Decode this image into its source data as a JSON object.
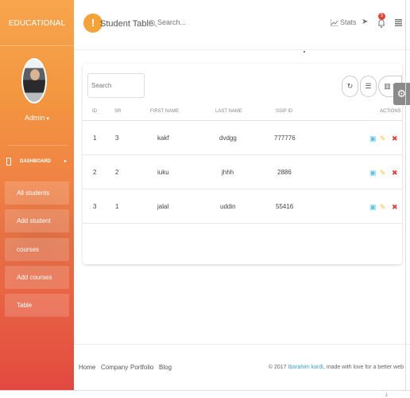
{
  "sidebar": {
    "logo": "EDUCATIONAL",
    "user_name": "Admin",
    "items": [
      {
        "label": "DASHBOARD"
      },
      {
        "label": "All students"
      },
      {
        "label": "Add student"
      },
      {
        "label": "courses"
      },
      {
        "label": "Add courses"
      },
      {
        "label": "Table"
      }
    ]
  },
  "topbar": {
    "menu_icon_glyph": "!",
    "title": "Student Table",
    "search_placeholder": "Search...",
    "stats_label": "Stats",
    "notification_count": "5"
  },
  "table": {
    "search_placeholder": "Search",
    "buttons": {
      "refresh": "↻",
      "columns": "☰",
      "export": "▥ ▾"
    },
    "headers": {
      "id": "ID",
      "sr": "SR",
      "first_name": "FIRST NAME",
      "last_name": "LAST NAME",
      "ssip_id": "SSIP ID",
      "actions": "ACTIONS"
    },
    "rows": [
      {
        "id": "1",
        "sr": "3",
        "first_name": "kakf",
        "last_name": "dvdgg",
        "ssip_id": "777776"
      },
      {
        "id": "2",
        "sr": "2",
        "first_name": "iuku",
        "last_name": "jhhh",
        "ssip_id": "2886"
      },
      {
        "id": "3",
        "sr": "1",
        "first_name": "jalal",
        "last_name": "uddin",
        "ssip_id": "55416"
      }
    ],
    "action_glyphs": {
      "view": "▣",
      "edit": "✎",
      "delete": "✖"
    }
  },
  "footer": {
    "links": [
      "Home",
      "Company",
      "Portfolio",
      "Blog"
    ],
    "copyright_prefix": "© 2017 ",
    "author": "Ibarahim kardi",
    "copyright_suffix": ", made with love for a better web"
  },
  "colors": {
    "accent": "#f4a23a",
    "sidebar_top": "#f7a54e",
    "sidebar_bottom": "#e2493f",
    "view_icon": "#5fc3e4",
    "edit_icon": "#f4c23a",
    "delete_icon": "#e4413b",
    "link": "#3aa0d6"
  }
}
